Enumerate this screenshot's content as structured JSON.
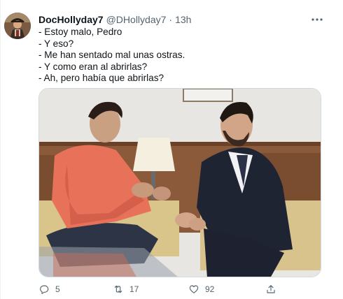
{
  "tweet": {
    "display_name": "DocHollyday7",
    "handle": "@DHollyday7",
    "separator": "·",
    "time": "13h",
    "more_icon": "ellipsis-icon",
    "lines": [
      "- Estoy malo, Pedro",
      "- Y eso?",
      "- Me han sentado mal unas ostras.",
      "- Y como eran al abrirlas?",
      "- Ah, pero había que abrirlas?"
    ],
    "actions": {
      "reply_count": "5",
      "retweet_count": "17",
      "like_count": "92",
      "share_count": ""
    }
  },
  "colors": {
    "text": "#0f1419",
    "secondary": "#536471",
    "border": "#cfd9de"
  }
}
